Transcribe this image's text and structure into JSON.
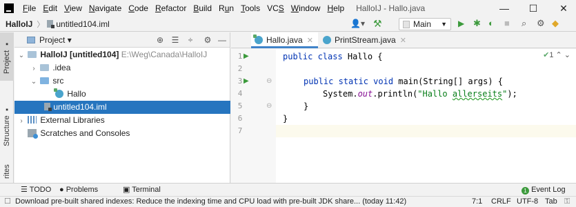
{
  "menu": {
    "items": [
      {
        "pre": "",
        "u": "F",
        "post": "ile"
      },
      {
        "pre": "",
        "u": "E",
        "post": "dit"
      },
      {
        "pre": "",
        "u": "V",
        "post": "iew"
      },
      {
        "pre": "",
        "u": "N",
        "post": "avigate"
      },
      {
        "pre": "",
        "u": "C",
        "post": "ode"
      },
      {
        "pre": "",
        "u": "R",
        "post": "efactor"
      },
      {
        "pre": "",
        "u": "B",
        "post": "uild"
      },
      {
        "pre": "R",
        "u": "u",
        "post": "n"
      },
      {
        "pre": "",
        "u": "T",
        "post": "ools"
      },
      {
        "pre": "VC",
        "u": "S",
        "post": ""
      },
      {
        "pre": "",
        "u": "W",
        "post": "indow"
      },
      {
        "pre": "",
        "u": "H",
        "post": "elp"
      }
    ],
    "window_title": "HalloIJ - Hallo.java",
    "minimize": "—",
    "maximize": "☐",
    "close": "✕"
  },
  "navbar": {
    "project": "HalloIJ",
    "separator": "〉",
    "file": "untitled104.iml",
    "run_config": "Main"
  },
  "left_stripe": {
    "project_tab": "Project",
    "structure_tab": "Structure",
    "favorites_tab": "rites"
  },
  "project_panel": {
    "title": "Project",
    "tree": {
      "root_name": "HalloIJ",
      "root_module": "[untitled104]",
      "root_path": "E:\\Weg\\Canada\\HalloIJ",
      "idea": ".idea",
      "src": "src",
      "hallo": "Hallo",
      "iml": "untitled104.iml",
      "ext_libs": "External Libraries",
      "scratches": "Scratches and Consoles"
    }
  },
  "editor": {
    "tabs": [
      "Hallo.java",
      "PrintStream.java"
    ],
    "line_numbers": [
      "1",
      "2",
      "3",
      "4",
      "5",
      "6",
      "7"
    ],
    "code": {
      "l1_kw": "public class",
      "l1_rest": " Hallo {",
      "l3_kw": "public static void",
      "l3_rest": " main(String[] args) {",
      "l4_a": "System.",
      "l4_out": "out",
      "l4_b": ".println(",
      "l4_str_a": "\"Hallo ",
      "l4_str_u": "allerseits",
      "l4_str_b": "\"",
      "l4_c": ");",
      "l5": "}",
      "l6": "}"
    },
    "inspection_count": "1"
  },
  "bottom_tools": {
    "todo": "TODO",
    "problems": "Problems",
    "terminal": "Terminal",
    "event_log": "Event Log",
    "event_log_count": "1"
  },
  "status_bar": {
    "message": "Download pre-built shared indexes: Reduce the indexing time and CPU load with pre-built JDK share... (today 11:42)",
    "position": "7:1",
    "line_sep": "CRLF",
    "encoding": "UTF-8",
    "indent": "Tab"
  },
  "colors": {
    "selection": "#2675bf",
    "keyword": "#0033b3",
    "string": "#067d17",
    "run_green": "#3c9a3c"
  }
}
